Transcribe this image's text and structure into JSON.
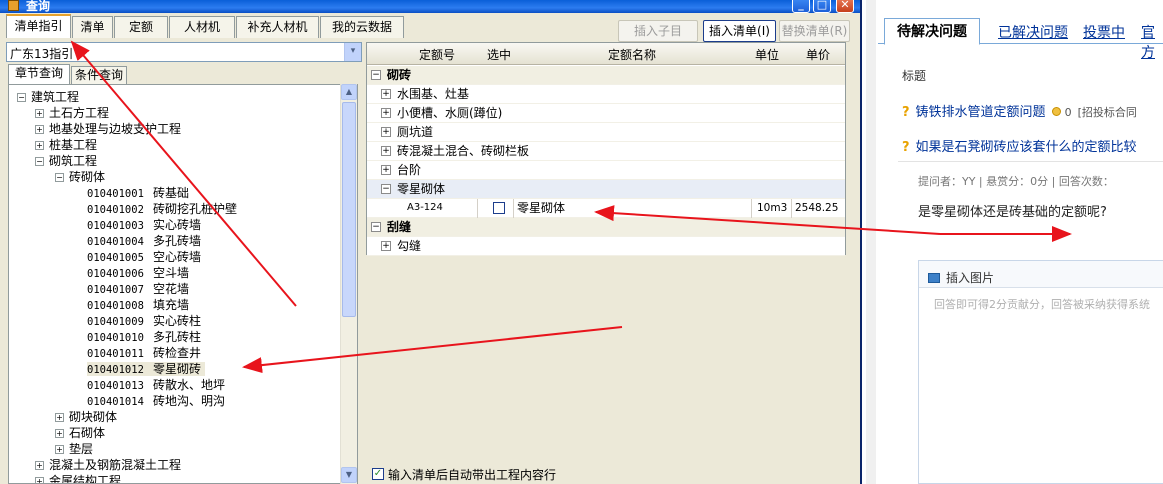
{
  "window": {
    "title": "查询",
    "min": "_",
    "max": "□",
    "close": "✕"
  },
  "tabs": [
    "清单指引",
    "清单",
    "定额",
    "人材机",
    "补充人材机",
    "我的云数据"
  ],
  "toolbar": {
    "insert_child": "插入子目",
    "insert_qd": "插入清单(I)",
    "replace_qd": "替换清单(R)"
  },
  "combo": {
    "value": "广东13指引",
    "arrow": "▾"
  },
  "subtabs": [
    "章节查询",
    "条件查询"
  ],
  "tree": [
    {
      "indent": 0,
      "ex": "−",
      "code": "",
      "label": "建筑工程"
    },
    {
      "indent": 1,
      "ex": "+",
      "code": "",
      "label": "土石方工程"
    },
    {
      "indent": 1,
      "ex": "+",
      "code": "",
      "label": "地基处理与边坡支护工程"
    },
    {
      "indent": 1,
      "ex": "+",
      "code": "",
      "label": "桩基工程"
    },
    {
      "indent": 1,
      "ex": "−",
      "code": "",
      "label": "砌筑工程"
    },
    {
      "indent": 2,
      "ex": "−",
      "code": "",
      "label": "砖砌体"
    },
    {
      "indent": 3,
      "ex": "",
      "code": "010401001",
      "label": "砖基础"
    },
    {
      "indent": 3,
      "ex": "",
      "code": "010401002",
      "label": "砖砌挖孔桩护壁"
    },
    {
      "indent": 3,
      "ex": "",
      "code": "010401003",
      "label": "实心砖墙"
    },
    {
      "indent": 3,
      "ex": "",
      "code": "010401004",
      "label": "多孔砖墙"
    },
    {
      "indent": 3,
      "ex": "",
      "code": "010401005",
      "label": "空心砖墙"
    },
    {
      "indent": 3,
      "ex": "",
      "code": "010401006",
      "label": "空斗墙"
    },
    {
      "indent": 3,
      "ex": "",
      "code": "010401007",
      "label": "空花墙"
    },
    {
      "indent": 3,
      "ex": "",
      "code": "010401008",
      "label": "填充墙"
    },
    {
      "indent": 3,
      "ex": "",
      "code": "010401009",
      "label": "实心砖柱"
    },
    {
      "indent": 3,
      "ex": "",
      "code": "010401010",
      "label": "多孔砖柱"
    },
    {
      "indent": 3,
      "ex": "",
      "code": "010401011",
      "label": "砖检查井"
    },
    {
      "indent": 3,
      "ex": "",
      "code": "010401012",
      "label": "零星砌砖",
      "selected": true
    },
    {
      "indent": 3,
      "ex": "",
      "code": "010401013",
      "label": "砖散水、地坪"
    },
    {
      "indent": 3,
      "ex": "",
      "code": "010401014",
      "label": "砖地沟、明沟"
    },
    {
      "indent": 2,
      "ex": "+",
      "code": "",
      "label": "砌块砌体"
    },
    {
      "indent": 2,
      "ex": "+",
      "code": "",
      "label": "石砌体"
    },
    {
      "indent": 2,
      "ex": "+",
      "code": "",
      "label": "垫层"
    },
    {
      "indent": 1,
      "ex": "+",
      "code": "",
      "label": "混凝土及钢筋混凝土工程"
    },
    {
      "indent": 1,
      "ex": "+",
      "code": "",
      "label": "金属结构工程"
    }
  ],
  "scroll": {
    "up": "▲",
    "down": "▼",
    "grip": "≡"
  },
  "grid": {
    "headers": [
      "定额号",
      "选中",
      "定额名称",
      "单位",
      "单价"
    ],
    "rows": [
      {
        "kind": "group",
        "ex": "−",
        "label": "砌砖"
      },
      {
        "kind": "sub",
        "ex": "+",
        "label": "水围基、灶基"
      },
      {
        "kind": "sub",
        "ex": "+",
        "label": "小便槽、水厕(蹲位)"
      },
      {
        "kind": "sub",
        "ex": "+",
        "label": "厕坑道"
      },
      {
        "kind": "sub",
        "ex": "+",
        "label": "砖混凝土混合、砖砌栏板"
      },
      {
        "kind": "sub",
        "ex": "+",
        "label": "台阶"
      },
      {
        "kind": "subactive",
        "ex": "−",
        "label": "零星砌体"
      },
      {
        "kind": "item",
        "code": "A3-124",
        "name": "零星砌体",
        "unit": "10m3",
        "price": "2548.25"
      },
      {
        "kind": "group",
        "ex": "−",
        "label": "刮缝"
      },
      {
        "kind": "sub",
        "ex": "+",
        "label": "勾缝"
      }
    ]
  },
  "status": {
    "check": "✓",
    "text": "输入清单后自动带出工程内容行"
  },
  "web": {
    "tabs": [
      "待解决问题",
      "已解决问题",
      "投票中",
      "官方"
    ],
    "title_label": "标题",
    "q1": "铸铁排水管道定额问题",
    "q1_score": "0",
    "q1_extra": "[招投标合同",
    "q2": "如果是石凳砌砖应该套什么的定额比较",
    "meta": "提问者：YY  |  悬赏分：0分  |  回答次数：",
    "body": "是零星砌体还是砖基础的定额呢?",
    "insert_img": "插入图片",
    "answer_placeholder": "回答即可得2分贡献分，回答被采纳获得系统"
  }
}
